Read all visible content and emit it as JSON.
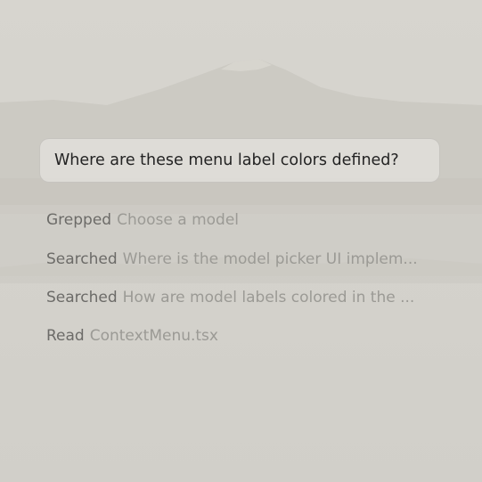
{
  "query": {
    "text": "Where are these menu label colors defined?"
  },
  "steps": [
    {
      "verb": "Grepped",
      "detail": "Choose a model"
    },
    {
      "verb": "Searched",
      "detail": "Where is the model picker UI implem..."
    },
    {
      "verb": "Searched",
      "detail": "How are model labels colored in the ..."
    },
    {
      "verb": "Read",
      "detail": "ContextMenu.tsx"
    }
  ],
  "colors": {
    "background": "#d3d1cb",
    "query_bubble": "#e2e0dc",
    "verb_text": "#6c6b68",
    "detail_text": "#9b9a95"
  },
  "background_image": "misty-mountain-lake-wallpaper"
}
